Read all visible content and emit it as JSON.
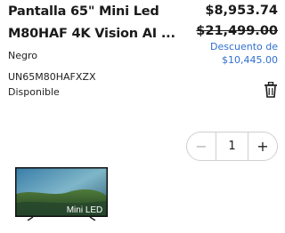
{
  "product": {
    "title": "Pantalla 65\" Mini Led M80HAF 4K Vision AI ...",
    "color": "Negro",
    "sku": "UN65M80HAFXZX",
    "availability": "Disponible",
    "image_label": "Mini LED"
  },
  "pricing": {
    "price": "$8,953.74",
    "original_price": "$21,499.00",
    "discount_label": "Descuento de",
    "discount_value": "$10,445.00"
  },
  "quantity": {
    "minus": "−",
    "value": "1",
    "plus": "+"
  },
  "icons": {
    "delete": "trash-icon"
  },
  "colors": {
    "discount": "#2f6fcf",
    "text": "#1a1a1a"
  }
}
